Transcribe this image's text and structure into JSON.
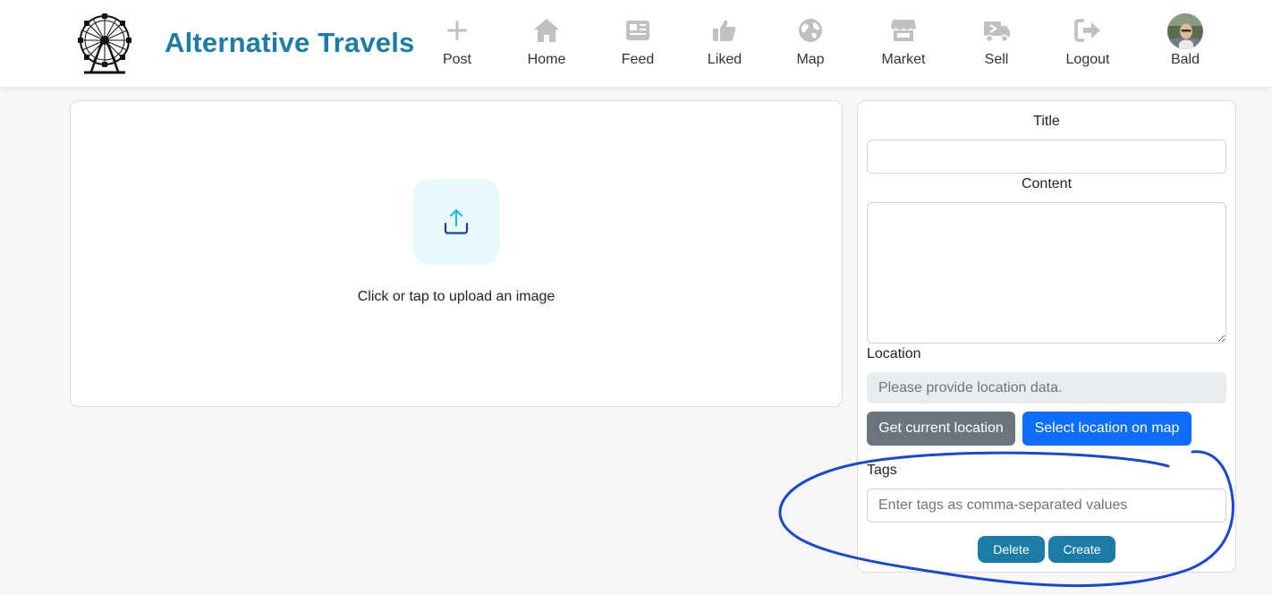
{
  "brand": {
    "title": "Alternative Travels",
    "logo_icon": "ferris-wheel-icon",
    "title_color": "#1b7da6"
  },
  "nav": {
    "items": [
      {
        "label": "Post",
        "icon": "plus-icon"
      },
      {
        "label": "Home",
        "icon": "home-icon"
      },
      {
        "label": "Feed",
        "icon": "newspaper-icon"
      },
      {
        "label": "Liked",
        "icon": "thumbs-up-icon"
      },
      {
        "label": "Map",
        "icon": "globe-icon"
      },
      {
        "label": "Market",
        "icon": "store-icon"
      },
      {
        "label": "Sell",
        "icon": "truck-icon"
      },
      {
        "label": "Logout",
        "icon": "logout-icon"
      },
      {
        "label": "Bald",
        "icon": "avatar"
      }
    ],
    "icon_color": "#c0c0c0"
  },
  "upload": {
    "text": "Click or tap to upload an image",
    "icon": "upload-icon"
  },
  "form": {
    "title_label": "Title",
    "title_value": "",
    "content_label": "Content",
    "content_value": "",
    "location_label": "Location",
    "location_placeholder": "Please provide location data.",
    "get_location_button": "Get current location",
    "select_location_button": "Select location on map",
    "tags_label": "Tags",
    "tags_placeholder": "Enter tags as comma-separated values",
    "delete_button": "Delete",
    "create_button": "Create"
  },
  "colors": {
    "accent": "#1b7da6",
    "primary": "#0d6efd",
    "secondary": "#6c757d",
    "annotation": "#1a46d6"
  }
}
